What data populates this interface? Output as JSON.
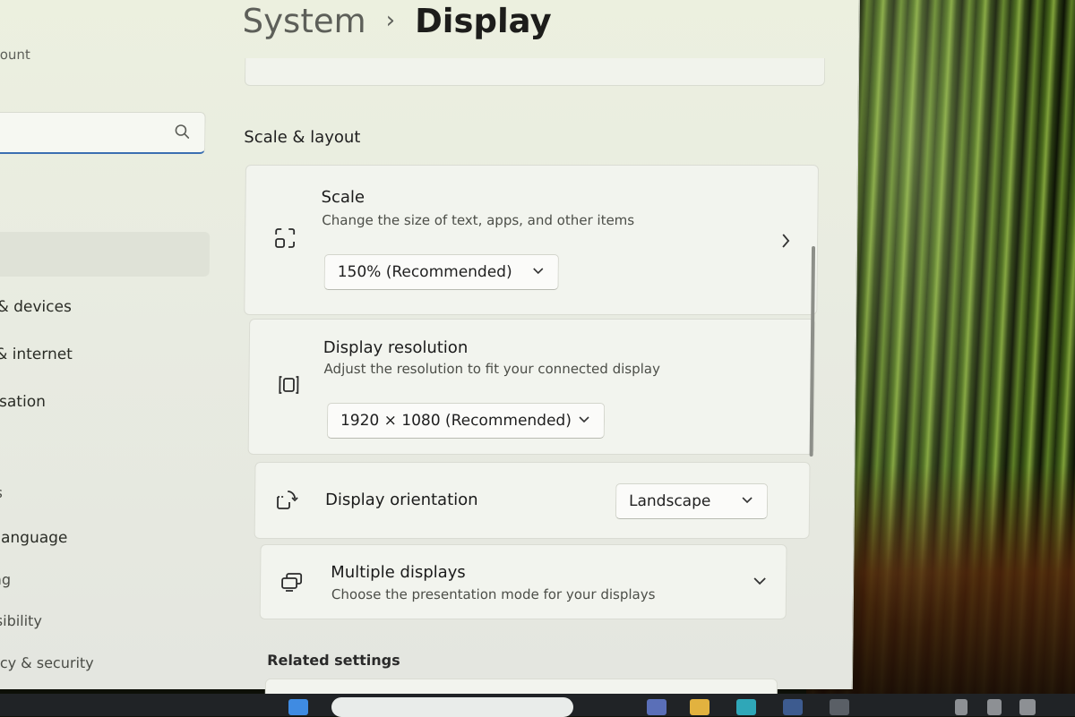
{
  "window": {
    "breadcrumb": {
      "parent": "System",
      "separator": "›",
      "current": "Display"
    }
  },
  "sidebar": {
    "account_label": "ccount",
    "search": {
      "placeholder": ""
    },
    "items": [
      {
        "label": "h & devices"
      },
      {
        "label": "k & internet"
      },
      {
        "label": "alisation"
      },
      {
        "label": "nts"
      },
      {
        "label": "& language"
      },
      {
        "label": "ning"
      },
      {
        "label": "essibility"
      },
      {
        "label": "ivacy & security"
      }
    ]
  },
  "main": {
    "section_title": "Scale & layout",
    "scale": {
      "title": "Scale",
      "description": "Change the size of text, apps, and other items",
      "value": "150% (Recommended)",
      "icon": "scale-icon"
    },
    "resolution": {
      "title": "Display resolution",
      "description": "Adjust the resolution to fit your connected display",
      "value": "1920 × 1080 (Recommended)",
      "icon": "resolution-icon"
    },
    "orientation": {
      "title": "Display orientation",
      "value": "Landscape",
      "icon": "orientation-icon"
    },
    "multiple": {
      "title": "Multiple displays",
      "description": "Choose the presentation mode for your displays",
      "icon": "multiple-displays-icon"
    },
    "related_title": "Related settings"
  },
  "colors": {
    "accent": "#3b6fb1",
    "card": "#f2f4ee",
    "window": "#ecf0df"
  }
}
